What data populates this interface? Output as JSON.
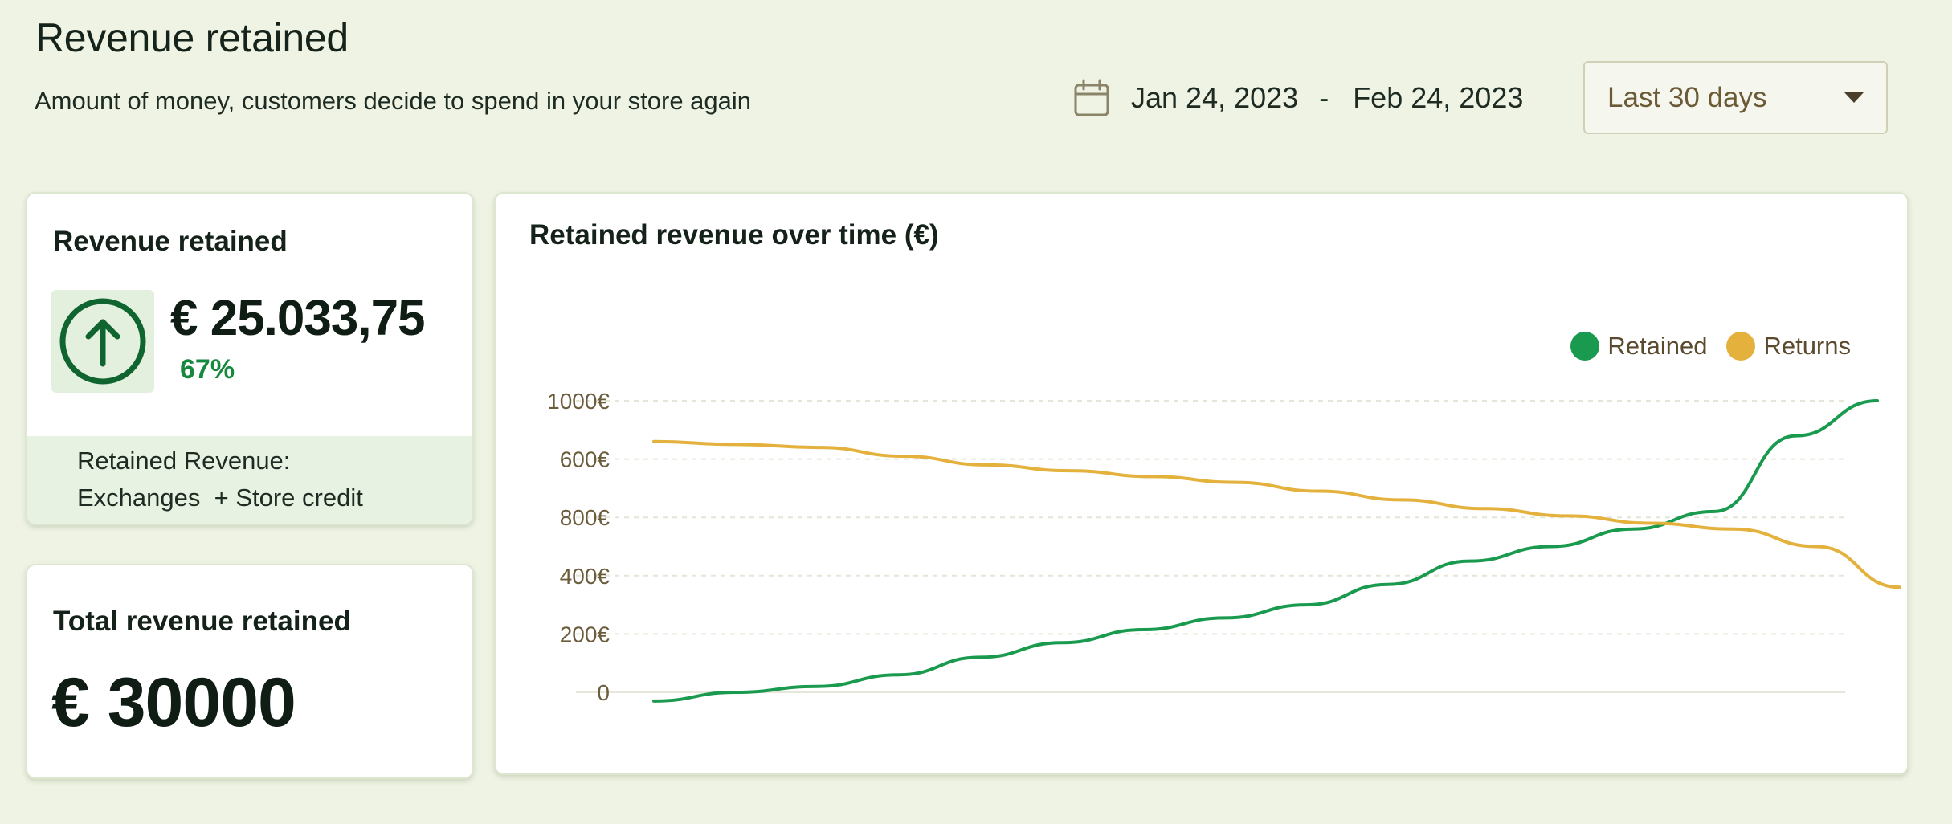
{
  "header": {
    "title": "Revenue retained",
    "subtitle": "Amount of money, customers decide to spend in your store again",
    "date_start": "Jan 24, 2023",
    "date_separator": "-",
    "date_end": "Feb 24, 2023",
    "range_select": "Last 30 days",
    "calendar_icon": "calendar-icon",
    "caret_icon": "chevron-down-icon"
  },
  "retained_card": {
    "heading": "Revenue retained",
    "amount": "€ 25.033,75",
    "percent": "67%",
    "icon": "arrow-up-circle-icon",
    "footer_line1": "Retained Revenue:",
    "footer_line2": "Exchanges  + Store credit"
  },
  "total_card": {
    "heading": "Total revenue retained",
    "amount": "€ 30000"
  },
  "chart_card": {
    "heading": "Retained revenue over time (€)"
  },
  "colors": {
    "background": "#eef3e4",
    "retained": "#1a9a4e",
    "returns": "#e3b13c",
    "accent_green": "#16893f",
    "icon_green": "#10642f"
  },
  "chart_data": {
    "type": "line",
    "title": "Retained revenue over time (€)",
    "y_tick_labels": [
      "1000€",
      "600€",
      "800€",
      "400€",
      "200€",
      "0"
    ],
    "grid": true,
    "legend_position": "top-right",
    "series": [
      {
        "name": "Retained",
        "color": "#1a9a4e",
        "values": [
          -30,
          0,
          20,
          60,
          120,
          170,
          215,
          255,
          300,
          370,
          450,
          500,
          560,
          620,
          880,
          1000
        ]
      },
      {
        "name": "Returns",
        "color": "#e3b13c",
        "values": [
          860,
          850,
          840,
          810,
          780,
          760,
          740,
          720,
          690,
          660,
          630,
          605,
          580,
          560,
          500,
          360
        ]
      }
    ]
  }
}
